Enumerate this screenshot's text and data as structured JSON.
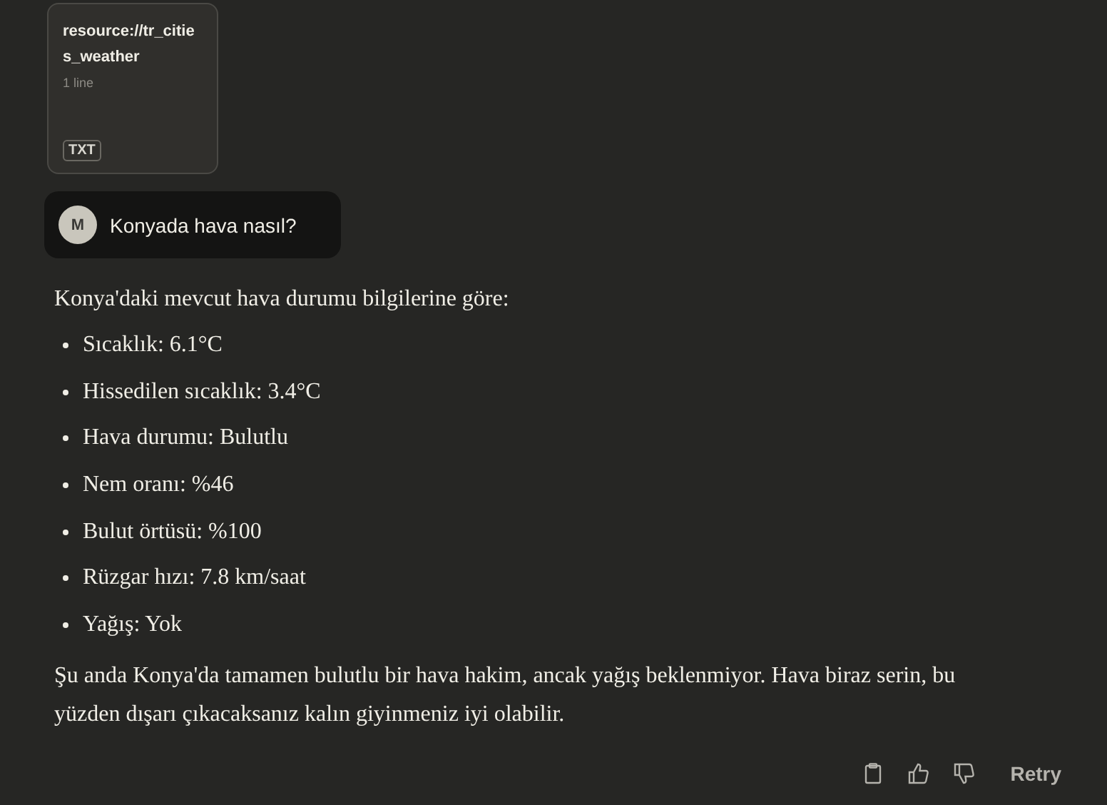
{
  "attachment": {
    "title": "resource://tr_cities_weather",
    "meta": "1 line",
    "badge": "TXT"
  },
  "user_message": {
    "avatar": "M",
    "text": "Konyada hava nasıl?"
  },
  "response": {
    "intro": "Konya'daki mevcut hava durumu bilgilerine göre:",
    "items": [
      "Sıcaklık: 6.1°C",
      "Hissedilen sıcaklık: 3.4°C",
      "Hava durumu: Bulutlu",
      "Nem oranı: %46",
      "Bulut örtüsü: %100",
      "Rüzgar hızı: 7.8 km/saat",
      "Yağış: Yok"
    ],
    "summary": "Şu anda Konya'da tamamen bulutlu bir hava hakim, ancak yağış beklenmiyor. Hava biraz serin, bu yüzden dışarı çıkacaksanız kalın giyinmeniz iyi olabilir."
  },
  "actions": {
    "retry": "Retry"
  }
}
